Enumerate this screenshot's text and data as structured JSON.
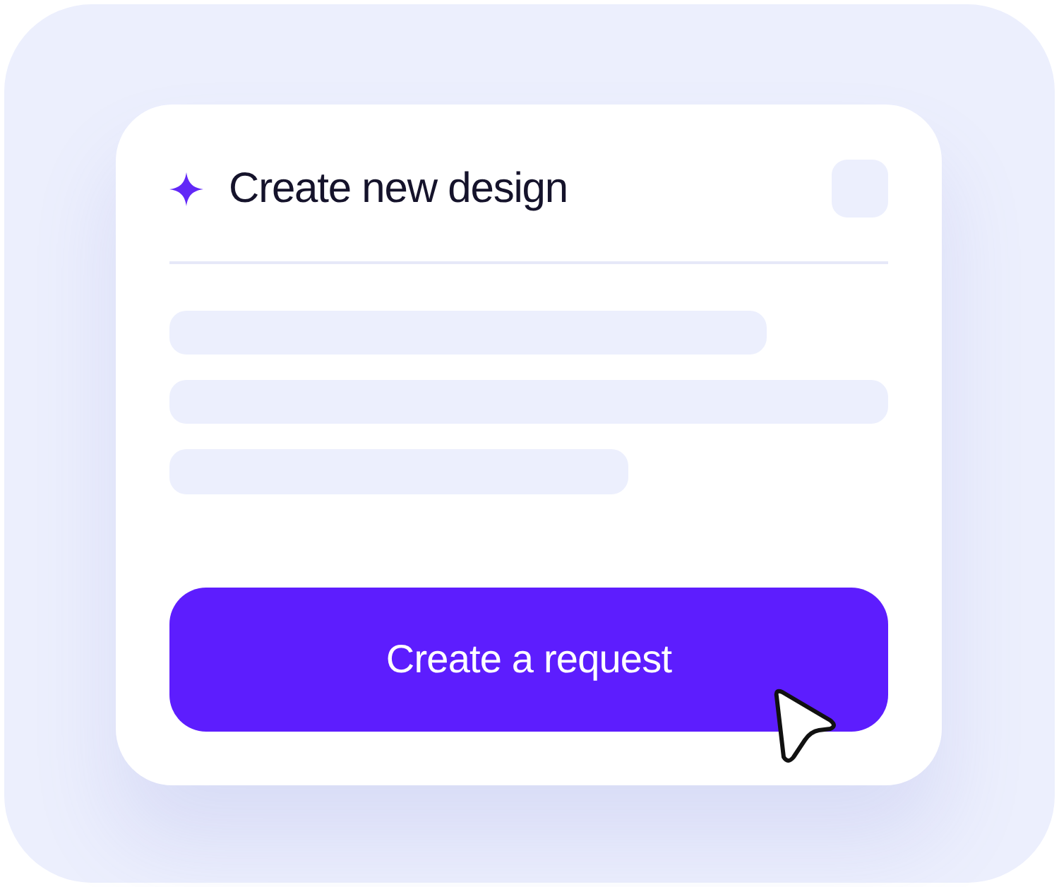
{
  "card": {
    "title": "Create new design"
  },
  "button": {
    "label": "Create a request"
  }
}
